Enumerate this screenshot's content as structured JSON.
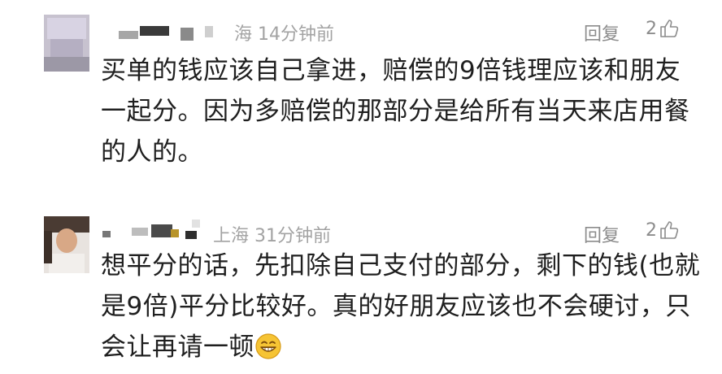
{
  "comments": [
    {
      "location_time": "海 14分钟前",
      "reply_label": "回复",
      "like_count": "2",
      "text": "买单的钱应该自己拿进，赔偿的9倍钱理应该和朋友一起分。因为多赔偿的那部分是给所有当天来店用餐的人的。",
      "icon": "thumbs-up-icon"
    },
    {
      "location_time": "上海 31分钟前",
      "reply_label": "回复",
      "like_count": "2",
      "text": "想平分的话，先扣除自己支付的部分，剩下的钱(也就是9倍)平分比较好。真的好朋友应该也不会硬讨，只会让再请一顿",
      "emoji": "grinning-face-emoji",
      "icon": "thumbs-up-icon"
    }
  ]
}
